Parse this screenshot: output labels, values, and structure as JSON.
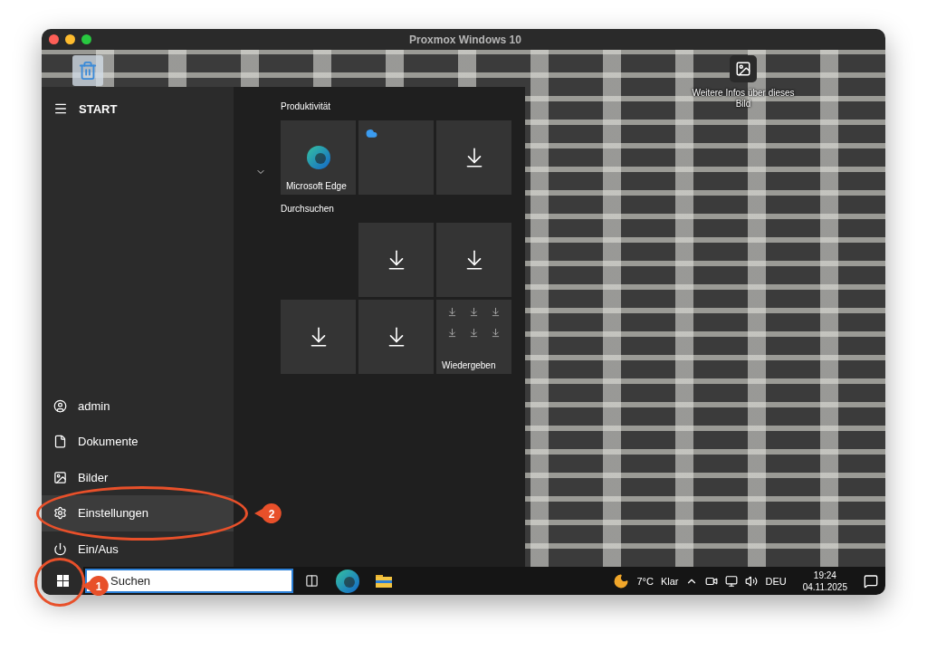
{
  "window": {
    "title": "Proxmox Windows 10"
  },
  "desktop": {
    "info_label": "Weitere Infos über dieses Bild"
  },
  "start_menu": {
    "title": "START",
    "items": [
      {
        "kind": "user",
        "label": "admin",
        "highlighted": false
      },
      {
        "kind": "document",
        "label": "Dokumente",
        "highlighted": false
      },
      {
        "kind": "image",
        "label": "Bilder",
        "highlighted": false
      },
      {
        "kind": "settings",
        "label": "Einstellungen",
        "highlighted": true
      },
      {
        "kind": "power",
        "label": "Ein/Aus",
        "highlighted": false
      }
    ],
    "groups": [
      {
        "title": "Produktivität",
        "tiles": [
          {
            "kind": "edge",
            "label": "Microsoft Edge"
          },
          {
            "kind": "onedrive"
          },
          {
            "kind": "download"
          }
        ]
      },
      {
        "title": "Durchsuchen",
        "tiles": [
          {
            "kind": "empty"
          },
          {
            "kind": "download"
          },
          {
            "kind": "download"
          },
          {
            "kind": "download"
          },
          {
            "kind": "download"
          },
          {
            "kind": "folder",
            "label": "Wiedergeben"
          }
        ]
      }
    ]
  },
  "taskbar": {
    "search": {
      "placeholder": "Suchen"
    },
    "weather": {
      "temperature": "7°C",
      "condition": "Klar"
    },
    "language": "DEU",
    "time": "19:24",
    "date": "04.11.2025"
  },
  "annotations": [
    {
      "label": "1"
    },
    {
      "label": "2"
    }
  ]
}
